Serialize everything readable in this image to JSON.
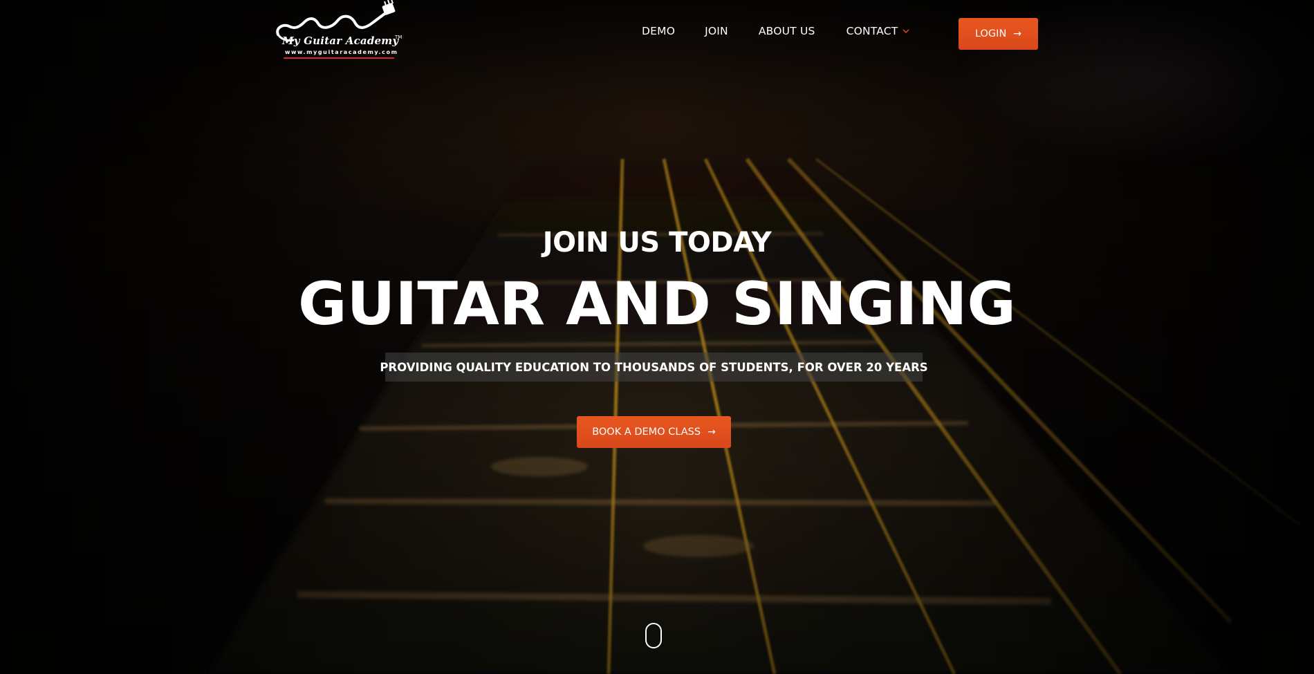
{
  "header": {
    "logo": {
      "name": "My Guitar Academy",
      "tm": "TM",
      "url": "www.myguitaracademy.com"
    },
    "nav": {
      "items": [
        {
          "label": "DEMO"
        },
        {
          "label": "JOIN"
        },
        {
          "label": "ABOUT US"
        },
        {
          "label": "CONTACT"
        }
      ]
    },
    "login": {
      "label": "LOGIN",
      "icon": "arrow-right-icon"
    }
  },
  "hero": {
    "subtitle": "JOIN US TODAY",
    "title": "GUITAR AND SINGING",
    "tagline": "PROVIDING QUALITY EDUCATION TO THOUSANDS OF STUDENTS, FOR OVER 20 YEARS",
    "cta": {
      "label": "BOOK A DEMO CLASS",
      "icon": "arrow-right-icon"
    },
    "scroll_indicator": "scroll-mouse-icon"
  },
  "colors": {
    "accent": "#e0501d",
    "logo_underline": "#d8272d",
    "text": "#ffffff",
    "background": "#050403"
  }
}
